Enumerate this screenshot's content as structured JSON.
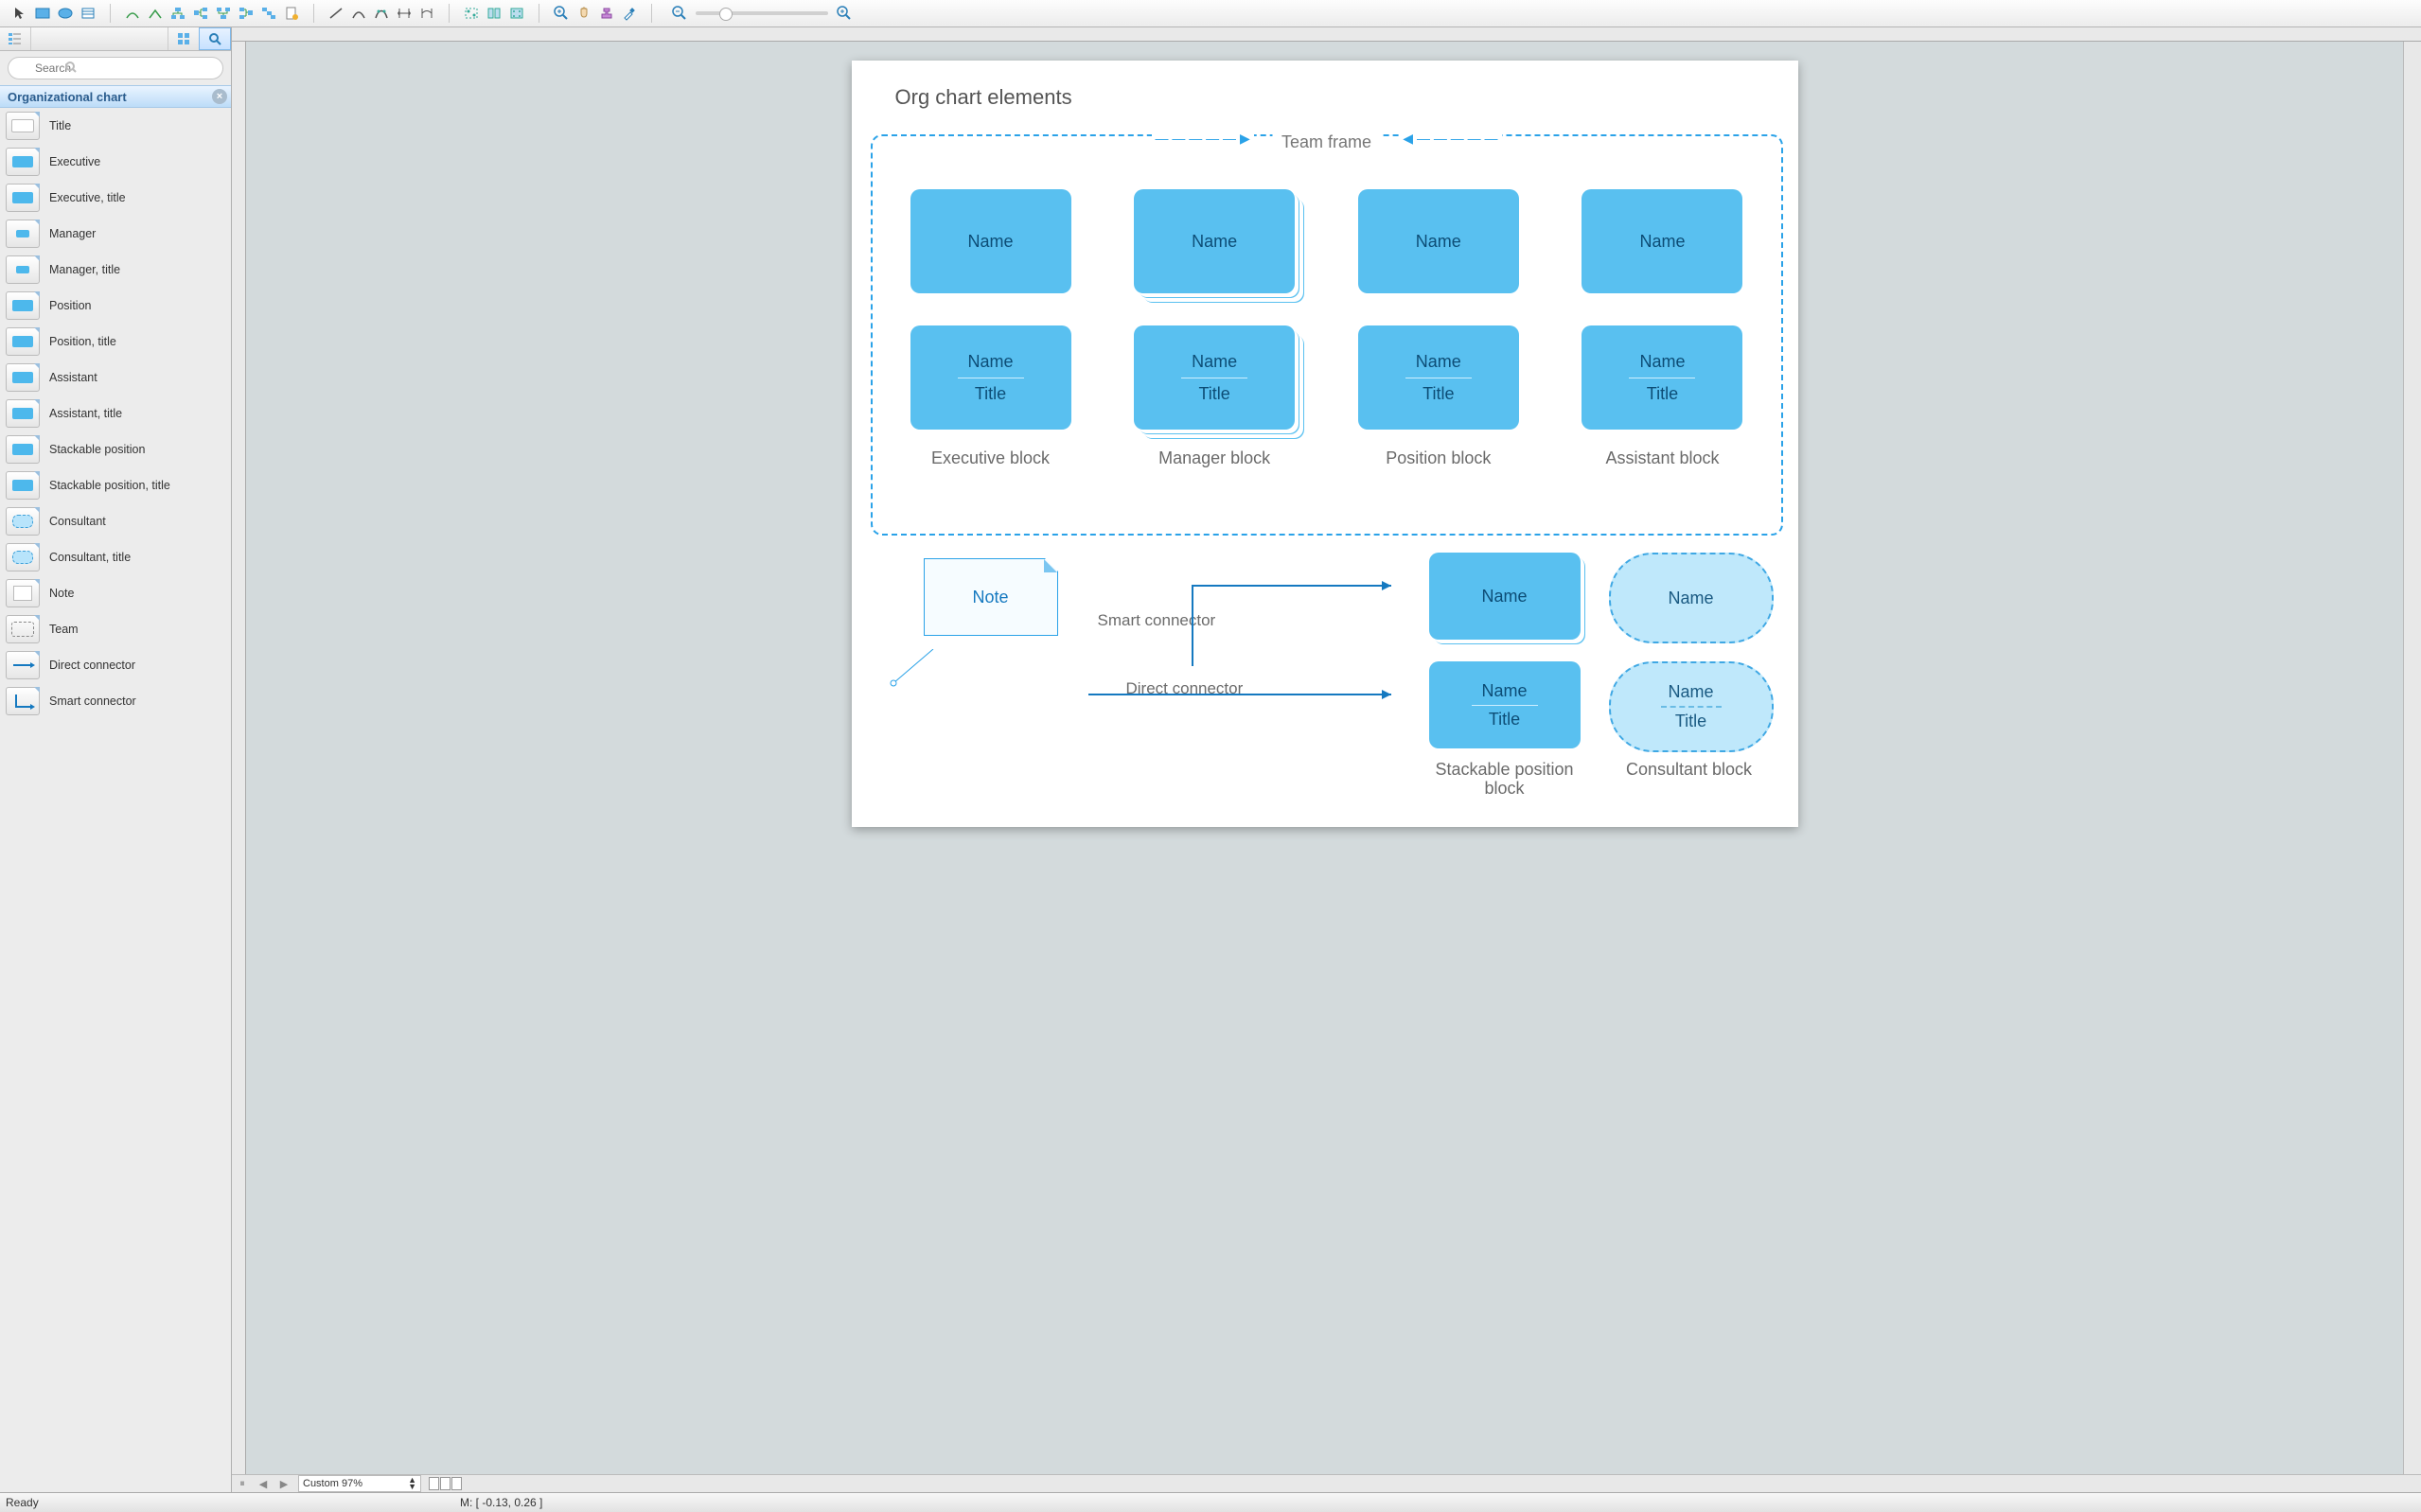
{
  "search": {
    "placeholder": "Search"
  },
  "section": {
    "title": "Organizational chart"
  },
  "shapes": [
    {
      "label": "Title"
    },
    {
      "label": "Executive"
    },
    {
      "label": "Executive, title"
    },
    {
      "label": "Manager"
    },
    {
      "label": "Manager, title"
    },
    {
      "label": "Position"
    },
    {
      "label": "Position, title"
    },
    {
      "label": "Assistant"
    },
    {
      "label": "Assistant, title"
    },
    {
      "label": "Stackable position"
    },
    {
      "label": "Stackable position, title"
    },
    {
      "label": "Consultant"
    },
    {
      "label": "Consultant, title"
    },
    {
      "label": "Note"
    },
    {
      "label": "Team"
    },
    {
      "label": "Direct connector"
    },
    {
      "label": "Smart connector"
    }
  ],
  "canvas": {
    "title": "Org chart elements",
    "team_label": "Team frame",
    "name": "Name",
    "title_text": "Title",
    "col_labels": [
      "Executive block",
      "Manager block",
      "Position block",
      "Assistant block"
    ],
    "note": "Note",
    "smart_conn": "Smart connector",
    "direct_conn": "Direct connector",
    "stack_label": "Stackable position block",
    "consultant_label": "Consultant block"
  },
  "footer": {
    "zoom": "Custom 97%",
    "status": "Ready",
    "coords": "M: [ -0.13, 0.26 ]"
  }
}
